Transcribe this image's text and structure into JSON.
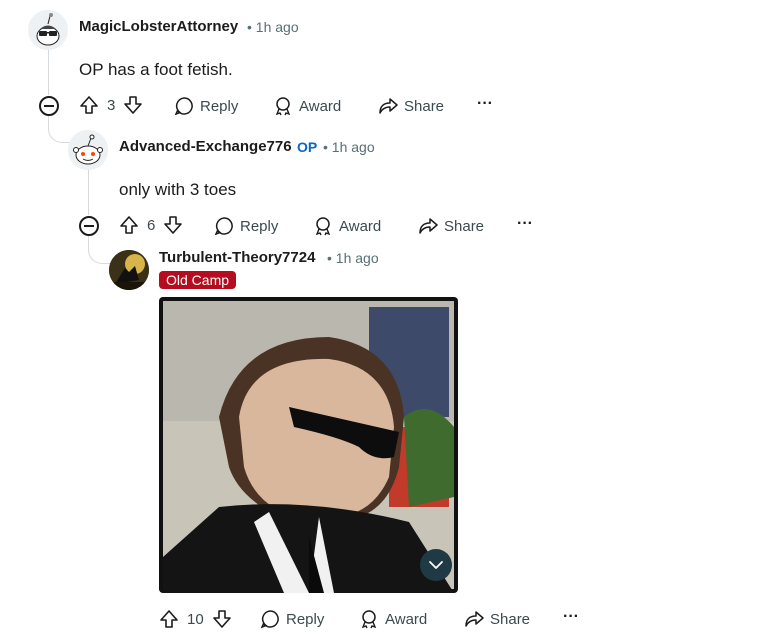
{
  "comments": [
    {
      "username": "MagicLobsterAttorney",
      "time": "• 1h ago",
      "body": "OP has a foot fetish.",
      "votes": "3"
    },
    {
      "username": "Advanced-Exchange776",
      "op_tag": "OP",
      "time": "• 1h ago",
      "body": "only with 3 toes",
      "votes": "6"
    },
    {
      "username": "Turbulent-Theory7724",
      "time": "• 1h ago",
      "flair": "Old Camp",
      "votes": "10"
    }
  ],
  "actions": {
    "reply": "Reply",
    "award": "Award",
    "share": "Share",
    "more": "···"
  }
}
